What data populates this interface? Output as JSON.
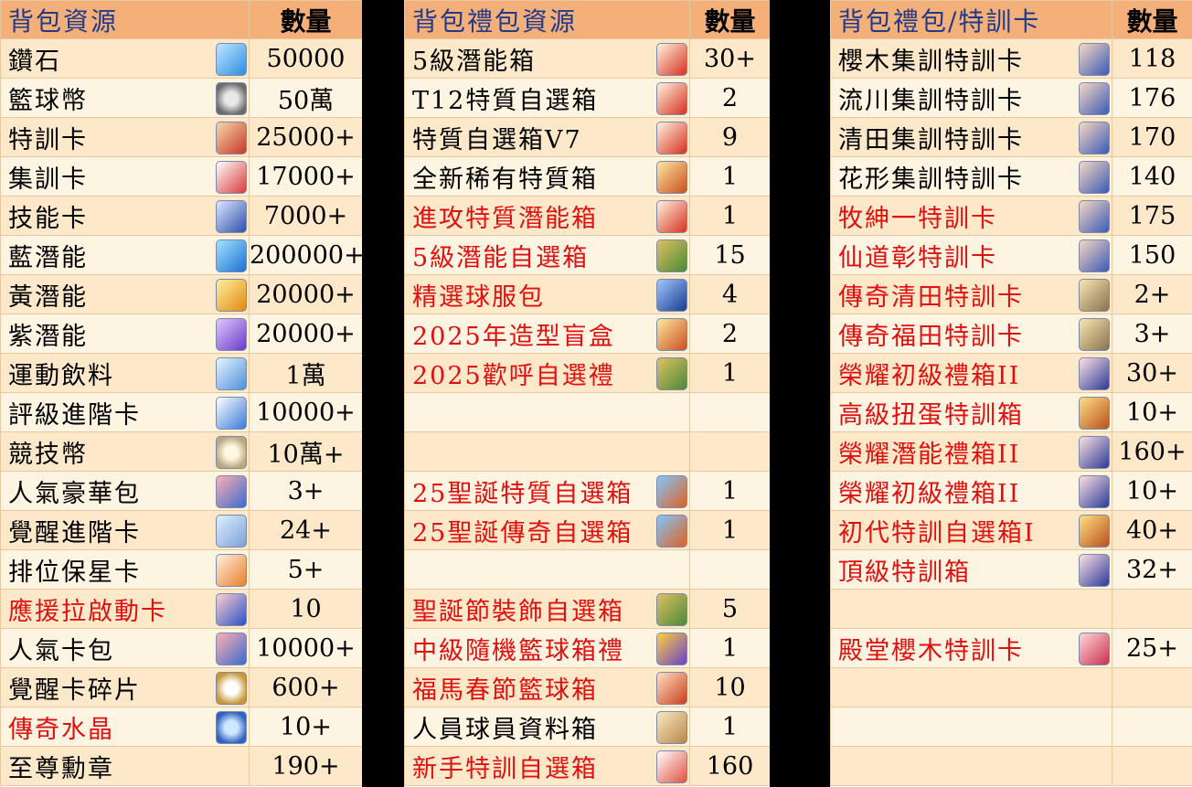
{
  "columns": [
    {
      "header_name": "背包資源",
      "header_qty": "數量",
      "rows": [
        {
          "name": "鑽石",
          "qty": "50000",
          "icon": "diamond-icon",
          "red": false
        },
        {
          "name": "籃球幣",
          "qty": "50萬",
          "icon": "coin-icon",
          "red": false
        },
        {
          "name": "特訓卡",
          "qty": "25000+",
          "icon": "card-icon",
          "red": false
        },
        {
          "name": "集訓卡",
          "qty": "17000+",
          "icon": "card2-icon",
          "red": false
        },
        {
          "name": "技能卡",
          "qty": "7000+",
          "icon": "card3-icon",
          "red": false
        },
        {
          "name": "藍潛能",
          "qty": "200000+",
          "icon": "gem-blue-icon",
          "red": false
        },
        {
          "name": "黃潛能",
          "qty": "20000+",
          "icon": "gem-yellow-icon",
          "red": false
        },
        {
          "name": "紫潛能",
          "qty": "20000+",
          "icon": "gem-purple-icon",
          "red": false
        },
        {
          "name": "運動飲料",
          "qty": "1萬",
          "icon": "bottle-icon",
          "red": false
        },
        {
          "name": "評級進階卡",
          "qty": "10000+",
          "icon": "ticket-icon",
          "red": false
        },
        {
          "name": "競技幣",
          "qty": "10萬+",
          "icon": "silver-icon",
          "red": false
        },
        {
          "name": "人氣豪華包",
          "qty": "3+",
          "icon": "pack-icon",
          "red": false
        },
        {
          "name": "覺醒進階卡",
          "qty": "24+",
          "icon": "scroll-icon",
          "red": false
        },
        {
          "name": "排位保星卡",
          "qty": "5+",
          "icon": "star-icon",
          "red": false
        },
        {
          "name": "應援拉啟動卡",
          "qty": "10",
          "icon": "rocket-icon",
          "red": true
        },
        {
          "name": "人氣卡包",
          "qty": "10000+",
          "icon": "pack-icon",
          "red": false
        },
        {
          "name": "覺醒卡碎片",
          "qty": "600+",
          "icon": "swirl-icon",
          "red": false
        },
        {
          "name": "傳奇水晶",
          "qty": "10+",
          "icon": "crystal-icon",
          "red": true
        },
        {
          "name": "至尊勳章",
          "qty": "190+",
          "icon": "",
          "red": false
        }
      ]
    },
    {
      "header_name": "背包禮包資源",
      "header_qty": "數量",
      "rows": [
        {
          "name": "5級潛能箱",
          "qty": "30+",
          "icon": "gift-red-icon",
          "red": false
        },
        {
          "name": "T12特質自選箱",
          "qty": "2",
          "icon": "gift-red-icon",
          "red": false
        },
        {
          "name": "特質自選箱V7",
          "qty": "9",
          "icon": "gift-red-icon",
          "red": false
        },
        {
          "name": "全新稀有特質箱",
          "qty": "1",
          "icon": "gift-gold-icon",
          "red": false
        },
        {
          "name": "進攻特質潛能箱",
          "qty": "1",
          "icon": "gift-red-icon",
          "red": true
        },
        {
          "name": "5級潛能自選箱",
          "qty": "15",
          "icon": "gift-multi-icon",
          "red": true
        },
        {
          "name": "精選球服包",
          "qty": "4",
          "icon": "gift-blue-icon",
          "red": true
        },
        {
          "name": "2025年造型盲盒",
          "qty": "2",
          "icon": "gift-gold-icon",
          "red": true
        },
        {
          "name": "2025歡呼自選禮",
          "qty": "1",
          "icon": "gift-multi-icon",
          "red": true
        },
        {
          "name": "",
          "qty": "",
          "icon": "",
          "red": false
        },
        {
          "name": "",
          "qty": "",
          "icon": "",
          "red": false
        },
        {
          "name": "25聖誕特質自選箱",
          "qty": "1",
          "icon": "gift-xmas-icon",
          "red": true
        },
        {
          "name": "25聖誕傳奇自選箱",
          "qty": "1",
          "icon": "gift-xmas-icon",
          "red": true
        },
        {
          "name": "",
          "qty": "",
          "icon": "",
          "red": false
        },
        {
          "name": "聖誕節裝飾自選箱",
          "qty": "5",
          "icon": "gift-multi-icon",
          "red": true
        },
        {
          "name": "中級隨機籃球箱禮",
          "qty": "1",
          "icon": "gift-purple-icon",
          "red": true
        },
        {
          "name": "福馬春節籃球箱",
          "qty": "10",
          "icon": "gift-ball-icon",
          "red": true
        },
        {
          "name": "人員球員資料箱",
          "qty": "1",
          "icon": "box-icon",
          "red": false
        },
        {
          "name": "新手特訓自選箱",
          "qty": "160",
          "icon": "gift-white-icon",
          "red": true
        }
      ]
    },
    {
      "header_name": "背包禮包/特訓卡",
      "header_qty": "數量",
      "rows": [
        {
          "name": "櫻木集訓特訓卡",
          "qty": "118",
          "icon": "player-icon",
          "red": false
        },
        {
          "name": "流川集訓特訓卡",
          "qty": "176",
          "icon": "player-icon",
          "red": false
        },
        {
          "name": "清田集訓特訓卡",
          "qty": "170",
          "icon": "player-icon",
          "red": false
        },
        {
          "name": "花形集訓特訓卡",
          "qty": "140",
          "icon": "player-icon",
          "red": false
        },
        {
          "name": "牧紳一特訓卡",
          "qty": "175",
          "icon": "player-icon",
          "red": true
        },
        {
          "name": "仙道彰特訓卡",
          "qty": "150",
          "icon": "player-icon",
          "red": true
        },
        {
          "name": "傳奇清田特訓卡",
          "qty": "2+",
          "icon": "player-gold-icon",
          "red": true
        },
        {
          "name": "傳奇福田特訓卡",
          "qty": "3+",
          "icon": "player-gold-icon",
          "red": true
        },
        {
          "name": "榮耀初級禮箱II",
          "qty": "30+",
          "icon": "team-icon",
          "red": true
        },
        {
          "name": "高級扭蛋特訓箱",
          "qty": "10+",
          "icon": "team-gold-icon",
          "red": true
        },
        {
          "name": "榮耀潛能禮箱II",
          "qty": "160+",
          "icon": "team-icon",
          "red": true
        },
        {
          "name": "榮耀初級禮箱II",
          "qty": "10+",
          "icon": "team-icon",
          "red": true
        },
        {
          "name": "初代特訓自選箱I",
          "qty": "40+",
          "icon": "team-gold-icon",
          "red": true
        },
        {
          "name": "頂級特訓箱",
          "qty": "32+",
          "icon": "team-icon",
          "red": true
        },
        {
          "name": "",
          "qty": "",
          "icon": "",
          "red": false
        },
        {
          "name": "殿堂櫻木特訓卡",
          "qty": "25+",
          "icon": "hall-icon",
          "red": true
        },
        {
          "name": "",
          "qty": "",
          "icon": "",
          "red": false
        },
        {
          "name": "",
          "qty": "",
          "icon": "",
          "red": false
        },
        {
          "name": "",
          "qty": "",
          "icon": "",
          "red": false
        }
      ]
    }
  ]
}
